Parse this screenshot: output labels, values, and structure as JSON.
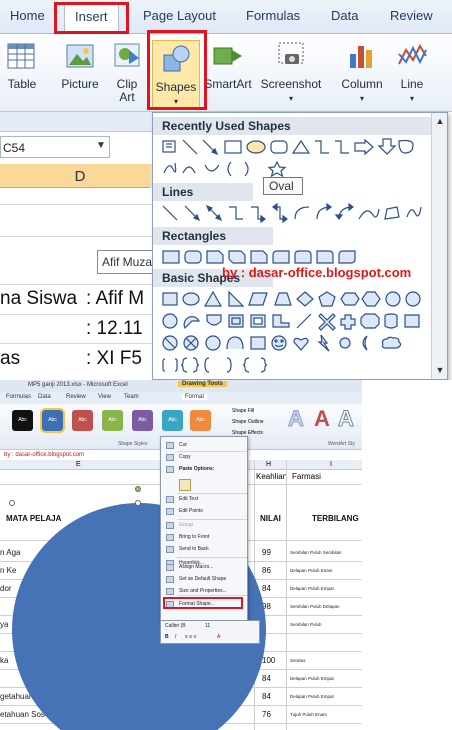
{
  "ribbon_tabs": [
    "Home",
    "Insert",
    "Page Layout",
    "Formulas",
    "Data",
    "Review"
  ],
  "ribbon_buttons": {
    "table": "Table",
    "picture": "Picture",
    "clip_art_1": "Clip",
    "clip_art_2": "Art",
    "shapes": "Shapes",
    "smartart": "SmartArt",
    "screenshot": "Screenshot",
    "column": "Column",
    "line": "Line"
  },
  "name_box": "C54",
  "column_header": "D",
  "sheet_cells": {
    "label_nama": "na Siswa",
    "colon_name": ": Afif M",
    "colon_date": ": 12.11",
    "label_kelas": "as",
    "colon_class": ": XI F5",
    "mini_cell": "Afif Muza"
  },
  "gallery": {
    "recent_title": "Recently Used Shapes",
    "lines_title": "Lines",
    "rectangles_title": "Rectangles",
    "basic_title": "Basic Shapes",
    "tooltip": "Oval"
  },
  "watermark": "by : dasar-office.blogspot.com",
  "bottom": {
    "title_bar": "MP5 ganji 2013.xlsx - Microsoft Excel",
    "drawing_tools": "Drawing Tools",
    "tabs": [
      "Formulas",
      "Data",
      "Review",
      "View",
      "Team",
      "Format"
    ],
    "style_labels": [
      "Abc",
      "Abc",
      "Abc",
      "Abc",
      "Abc",
      "Abc",
      "Abc"
    ],
    "style_colors": [
      "#111111",
      "#3e6fb3",
      "#c0504d",
      "#8ab34a",
      "#7b5ba6",
      "#3aa6c4",
      "#f0883e"
    ],
    "shape_fill": "Shape Fill",
    "shape_outline": "Shape Outline",
    "shape_effects": "Shape Effects",
    "shape_styles_group": "Shape Styles",
    "wordart_group": "WordArt Sty",
    "red_link": "by : dasar-office.blogspot.com",
    "col_e": "E",
    "col_h": "H",
    "col_i": "I",
    "keahlian": "Keahlian",
    "farmasi": "Farmasi",
    "head_mata": "MATA PELAJA",
    "head_nilai": "NILAI",
    "head_terbilang": "TERBILANG",
    "rows": [
      {
        "left": "n Aga",
        "num": "99",
        "word": "Sembilan Puluh Sembilan"
      },
      {
        "left": "n Ke",
        "num": "86",
        "word": "Delapan Puluh Enam"
      },
      {
        "left": "dor",
        "num": "84",
        "word": "Delapan Puluh Empat"
      },
      {
        "left": "",
        "num": "98",
        "word": "Sembilan Puluh Delapan"
      },
      {
        "left": "ya",
        "num": "",
        "word": "Sembilan Puluh"
      },
      {
        "left": "",
        "num": "",
        "word": ""
      },
      {
        "left": "ka",
        "num": "100",
        "word": "Seratus"
      },
      {
        "left": "",
        "num": "84",
        "word": "Delapan Puluh Empat"
      },
      {
        "left": "getahuan",
        "num": "84",
        "word": "Delapan Puluh Empat"
      },
      {
        "left": "etahuan Sos",
        "num": "76",
        "word": "Tujuh Puluh Enam"
      }
    ],
    "context_menu": [
      "Cut",
      "Copy",
      "Paste Options:",
      "",
      "Edit Text",
      "Edit Points",
      "Group",
      "Bring to Front",
      "Send to Back",
      "Hyperlink...",
      "Assign Macro...",
      "Set as Default Shape",
      "Size and Properties...",
      "Format Shape..."
    ],
    "font_name": "Calibri (B",
    "font_size": "11"
  }
}
